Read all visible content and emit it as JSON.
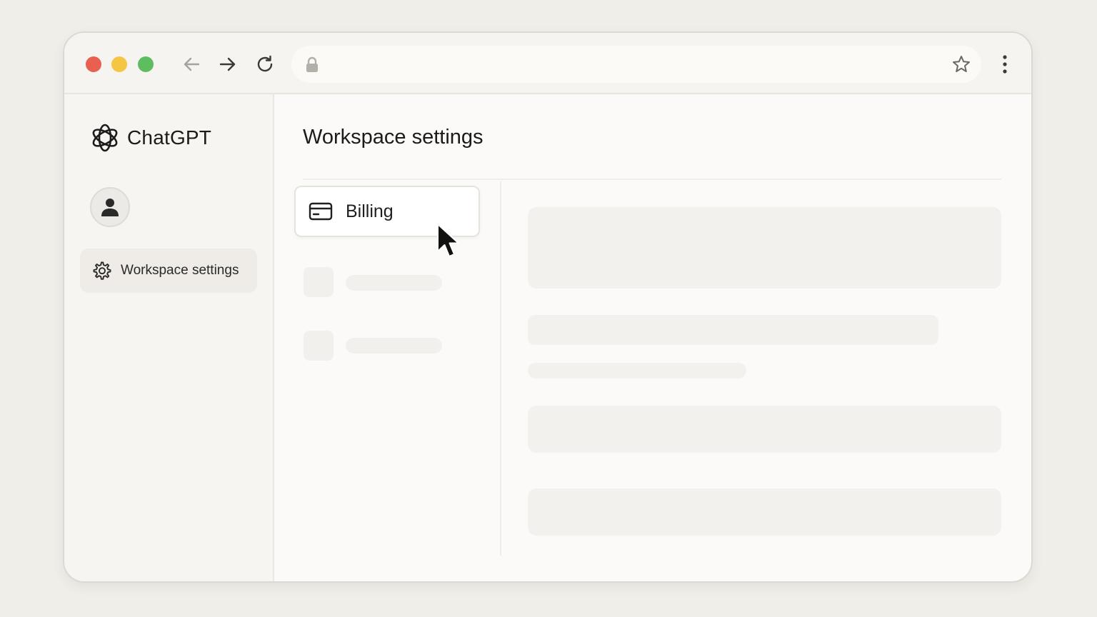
{
  "browser": {
    "traffic_lights": {
      "close_color": "#e8604f",
      "minimize_color": "#f4c644",
      "maximize_color": "#5ebd60"
    },
    "nav_icons": [
      "back-arrow-icon",
      "forward-arrow-icon",
      "reload-icon"
    ],
    "address_icon": "lock-icon",
    "bookmark_icon": "star-icon",
    "menu_icon": "kebab-menu-icon"
  },
  "sidebar": {
    "brand": "ChatGPT",
    "avatar_icon": "user-icon",
    "items": [
      {
        "label": "Workspace settings",
        "icon": "gear-icon",
        "active": true
      }
    ]
  },
  "main": {
    "title": "Workspace settings",
    "menu": [
      {
        "label": "Billing",
        "icon": "credit-card-icon",
        "hovered": true
      }
    ]
  },
  "colors": {
    "page_background": "#f0eee9",
    "window_background": "#fbfaf8",
    "placeholder": "#f2f0ec",
    "text": "#1d1d1b"
  }
}
